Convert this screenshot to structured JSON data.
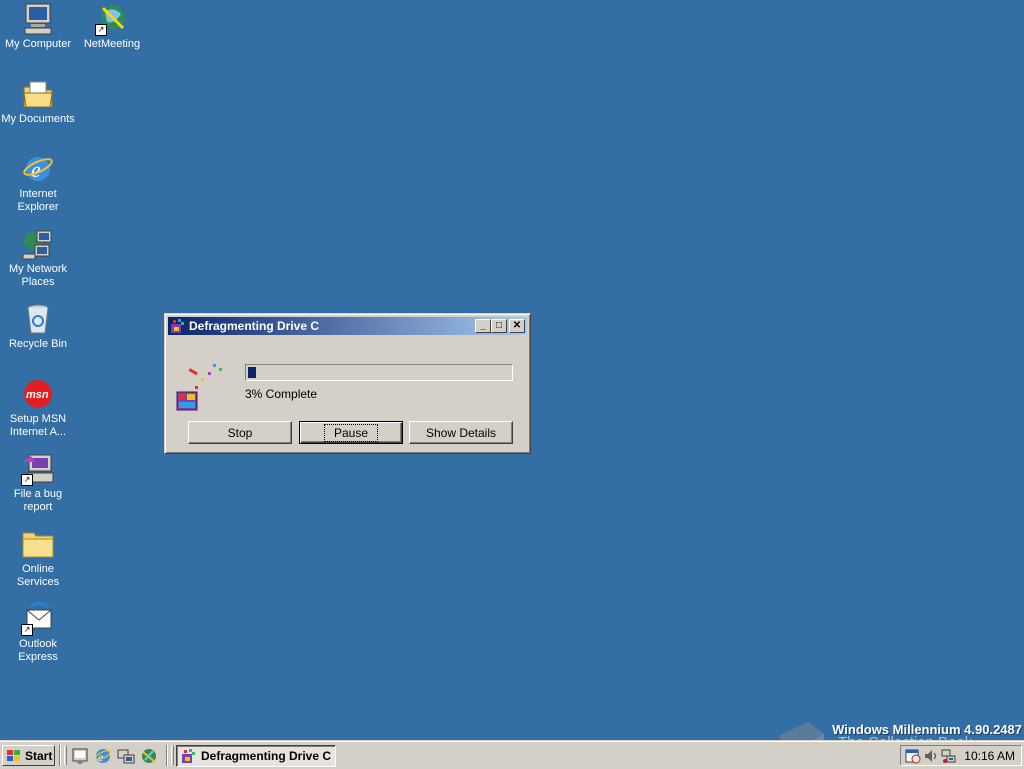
{
  "desktop": {
    "icons": [
      {
        "label": "My Computer",
        "icon": "my-computer-icon"
      },
      {
        "label": "NetMeeting",
        "icon": "netmeeting-icon"
      },
      {
        "label": "My Documents",
        "icon": "my-documents-icon"
      },
      {
        "label": "Internet Explorer",
        "icon": "internet-explorer-icon"
      },
      {
        "label": "My Network Places",
        "icon": "network-places-icon"
      },
      {
        "label": "Recycle Bin",
        "icon": "recycle-bin-icon"
      },
      {
        "label": "Setup MSN Internet A...",
        "icon": "msn-icon"
      },
      {
        "label": "File a bug report",
        "icon": "bug-report-icon"
      },
      {
        "label": "Online Services",
        "icon": "folder-icon"
      },
      {
        "label": "Outlook Express",
        "icon": "outlook-express-icon"
      }
    ],
    "background_color": "#336ea5"
  },
  "dialog": {
    "title": "Defragmenting Drive C",
    "progress_fraction": 0.03,
    "progress_text": "3% Complete",
    "buttons": {
      "stop": "Stop",
      "pause": "Pause",
      "details": "Show Details"
    },
    "title_controls": {
      "minimize": "_",
      "maximize": "□",
      "close": "✕"
    }
  },
  "watermark": {
    "version_text": "Windows Millennium 4.90.2487",
    "site_text": "The Collection Book"
  },
  "taskbar": {
    "start_label": "Start",
    "quick_launch": [
      "show-desktop-icon",
      "ie-quicklaunch-icon",
      "explorer-quicklaunch-icon",
      "media-player-icon"
    ],
    "task_label": "Defragmenting Drive C",
    "clock": "10:16 AM",
    "tray_icons": [
      "scheduler-icon",
      "volume-icon",
      "network-icon"
    ]
  }
}
